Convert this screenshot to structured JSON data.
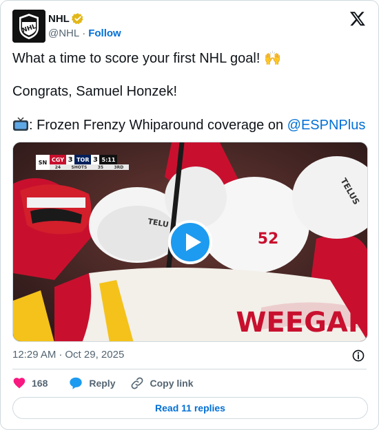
{
  "author": {
    "name": "NHL",
    "handle": "@NHL",
    "follow_label": "Follow",
    "verified": true,
    "avatar_icon": "nhl-shield-logo"
  },
  "post": {
    "line1": "What a time to score your first NHL goal! 🙌",
    "line2": "Congrats, Samuel Honzek!",
    "line3_prefix": ": Frozen Frenzy Whiparound coverage on ",
    "mention": "@ESPNPlus"
  },
  "media": {
    "scorebug": {
      "network": "SN",
      "team1": "CGY",
      "score1": "3",
      "team2": "TOR",
      "score2": "3",
      "clock": "5:11",
      "shots_label": "SHOTS",
      "shots1": "24",
      "shots2": "35",
      "period": "3RD"
    },
    "jersey_text": "WEEGAR",
    "helmet_number": "52",
    "helmet_brand": "TELUS"
  },
  "meta": {
    "time": "12:29 AM",
    "date": "Oct 29, 2025"
  },
  "actions": {
    "like_count": "168",
    "reply_label": "Reply",
    "copy_label": "Copy link"
  },
  "read_replies_label": "Read 11 replies",
  "colors": {
    "link": "#006fd6",
    "like": "#f91880",
    "reply": "#1d9bf0",
    "verified": "#e2b719"
  }
}
